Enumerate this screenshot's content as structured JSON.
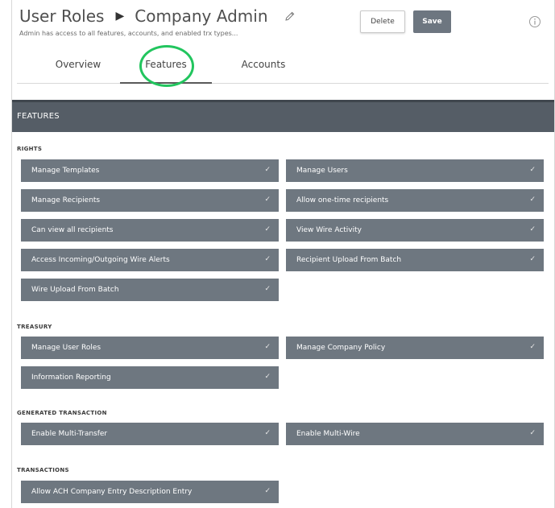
{
  "header": {
    "breadcrumb_parent": "User Roles",
    "breadcrumb_current": "Company Admin",
    "description": "Admin has access to all features, accounts, and enabled trx types...",
    "delete_label": "Delete",
    "save_label": "Save"
  },
  "tabs": [
    {
      "label": "Overview"
    },
    {
      "label": "Features",
      "selected": true
    },
    {
      "label": "Accounts"
    }
  ],
  "features_header": "FEATURES",
  "sections": {
    "rights": {
      "label": "RIGHTS",
      "items": [
        {
          "label": "Manage Templates",
          "enabled": true
        },
        {
          "label": "Manage Users",
          "enabled": true
        },
        {
          "label": "Manage Recipients",
          "enabled": true
        },
        {
          "label": "Allow one-time recipients",
          "enabled": true
        },
        {
          "label": "Can view all recipients",
          "enabled": true
        },
        {
          "label": "View Wire Activity",
          "enabled": true
        },
        {
          "label": "Access Incoming/Outgoing Wire Alerts",
          "enabled": true
        },
        {
          "label": "Recipient Upload From Batch",
          "enabled": true
        },
        {
          "label": "Wire Upload From Batch",
          "enabled": true
        }
      ]
    },
    "treasury": {
      "label": "TREASURY",
      "items": [
        {
          "label": "Manage User Roles",
          "enabled": true
        },
        {
          "label": "Manage Company Policy",
          "enabled": true
        },
        {
          "label": "Information Reporting",
          "enabled": true
        }
      ]
    },
    "generated_transaction": {
      "label": "GENERATED TRANSACTION",
      "items": [
        {
          "label": "Enable Multi-Transfer",
          "enabled": true
        },
        {
          "label": "Enable Multi-Wire",
          "enabled": true
        }
      ]
    },
    "transactions": {
      "label": "TRANSACTIONS",
      "items": [
        {
          "label": "Allow ACH Company Entry Description Entry",
          "enabled": true
        }
      ]
    }
  },
  "check_glyph": "✓",
  "colors": {
    "item_bg": "#6e7780",
    "header_bar": "#555d66",
    "save_button": "#6d7680",
    "highlight_ring": "#22c55e"
  },
  "icons": {
    "breadcrumb_separator": "triangle-right-icon",
    "edit": "pencil-icon",
    "info": "info-circle-icon",
    "check": "checkmark-icon"
  }
}
